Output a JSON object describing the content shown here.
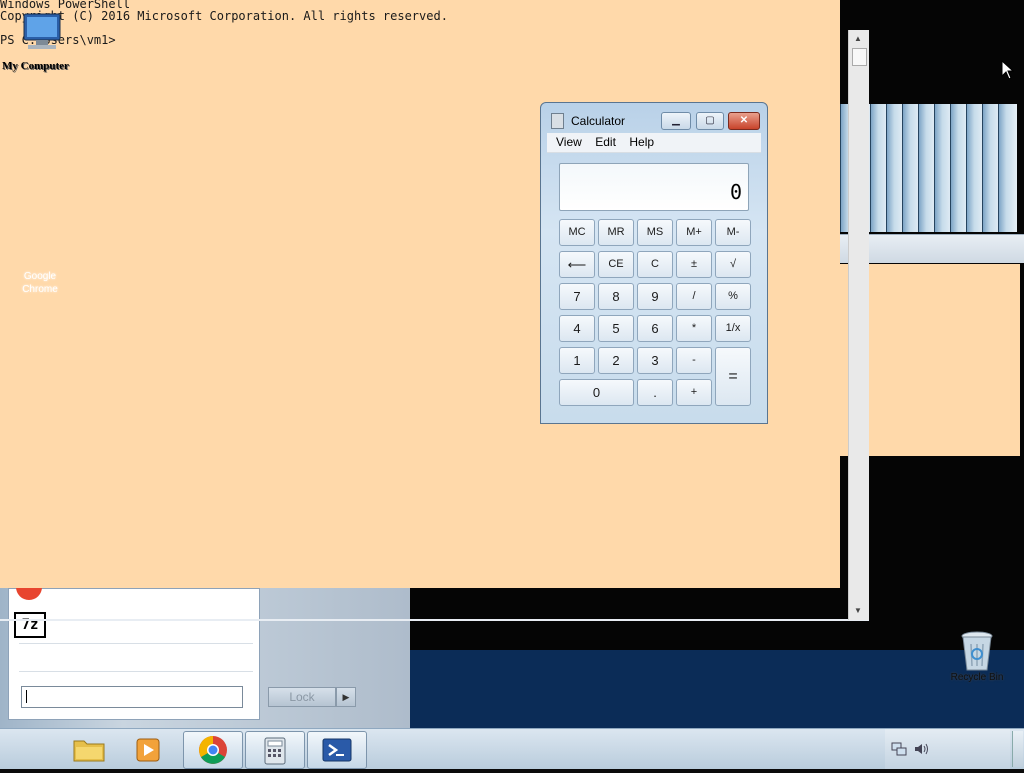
{
  "powershell": {
    "lines": [
      "Windows PowerShell",
      "Copyright (C) 2016 Microsoft Corporation. All rights reserved.",
      "",
      "PS C:\\Users\\vm1>"
    ]
  },
  "desktop_icons": {
    "my_computer": "My Computer",
    "google_chrome": "Google Chrome",
    "recycle_bin": "Recycle Bin"
  },
  "calculator": {
    "title": "Calculator",
    "menu": [
      "View",
      "Edit",
      "Help"
    ],
    "display": "0",
    "keys": {
      "row1": [
        "MC",
        "MR",
        "MS",
        "M+",
        "M-"
      ],
      "row2": [
        "⟵",
        "CE",
        "C",
        "±",
        "√"
      ],
      "row3": [
        "7",
        "8",
        "9",
        "/",
        "%"
      ],
      "row4": [
        "4",
        "5",
        "6",
        "*",
        "1/x"
      ],
      "row5": [
        "1",
        "2",
        "3",
        "-"
      ],
      "row6": [
        "0",
        ".",
        "+"
      ],
      "equals": "="
    }
  },
  "start_menu": {
    "search_placeholder": "",
    "lock_label": "Lock",
    "arrow": "▶"
  },
  "taskbar": {
    "items": [
      "file-explorer",
      "media-player",
      "google-chrome",
      "calculator",
      "powershell"
    ]
  }
}
